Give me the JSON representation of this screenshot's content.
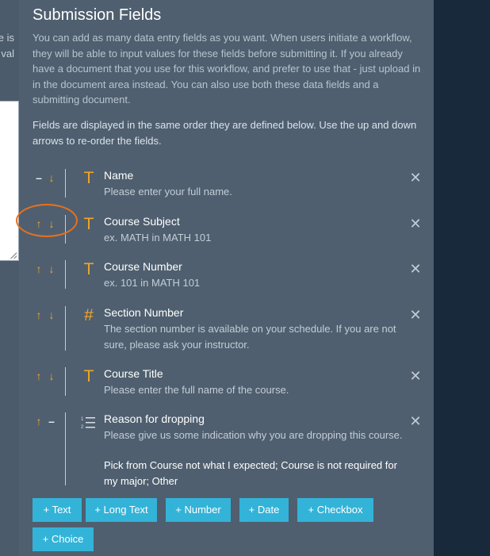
{
  "left_strip": {
    "text_1": "e is",
    "text_2": "val"
  },
  "panel": {
    "title": "Submission Fields",
    "description_1": "You can add as many data entry fields as you want. When users initiate a workflow, they will be able to input values for these fields before submitting it. If you already have a document that you use for this workflow, and prefer to use that - just upload in in the document area instead. You can also use both these data fields and a submitting document.",
    "description_2": "Fields are displayed in the same order they are defined below. Use the up and down arrows to re-order the fields."
  },
  "fields": [
    {
      "name": "Name",
      "hint": "Please enter your full name.",
      "type_icon": "T",
      "type": "text",
      "up": "–",
      "down": "↓"
    },
    {
      "name": "Course Subject",
      "hint": "ex. MATH in MATH 101",
      "type_icon": "T",
      "type": "text",
      "up": "↑",
      "down": "↓"
    },
    {
      "name": "Course Number",
      "hint": "ex. 101 in MATH 101",
      "type_icon": "T",
      "type": "text",
      "up": "↑",
      "down": "↓"
    },
    {
      "name": "Section Number",
      "hint": "The section number is available on your schedule. If you are not sure, please ask your instructor.",
      "type_icon": "#",
      "type": "number",
      "up": "↑",
      "down": "↓"
    },
    {
      "name": "Course Title",
      "hint": "Please enter the full name of the course.",
      "type_icon": "T",
      "type": "text",
      "up": "↑",
      "down": "↓"
    },
    {
      "name": "Reason for dropping",
      "hint": "Please give us some indication why you are dropping this course.",
      "options": "Pick from Course not what I expected; Course is not required for my major; Other",
      "type_icon": "list",
      "type": "choice",
      "up": "↑",
      "down": "–"
    }
  ],
  "close_glyph": "✕",
  "buttons": {
    "text": "+ Text",
    "long_text": "+ Long Text",
    "number": "+ Number",
    "date": "+ Date",
    "checkbox": "+ Checkbox",
    "choice": "+ Choice"
  },
  "colors": {
    "panel_bg": "#4f5f6f",
    "accent_orange": "#f0a628",
    "button_blue": "#33b3d8",
    "highlight_ring": "#e8701c"
  }
}
